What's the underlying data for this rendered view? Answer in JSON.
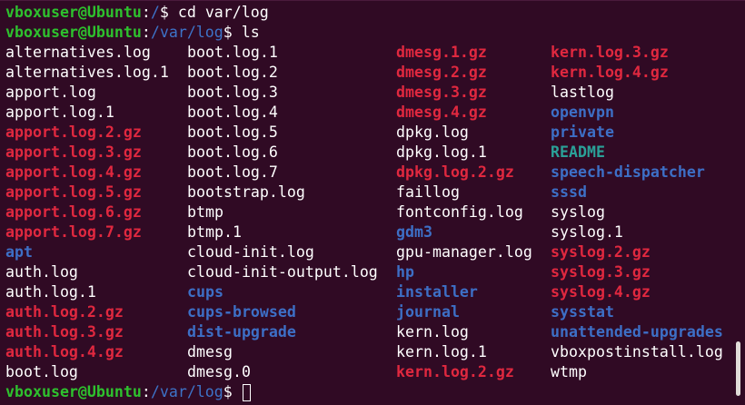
{
  "colors": {
    "background": "#300a24",
    "prompt_user": "#2ec12e",
    "prompt_path": "#3d73c8",
    "text": "#ffffff",
    "archive": "#e0283f",
    "directory": "#3d6fc6",
    "special": "#2aa198"
  },
  "prompts": [
    {
      "user": "vboxuser@Ubuntu",
      "sep": ":",
      "path": "/",
      "dollar": "$ ",
      "command": "cd var/log"
    },
    {
      "user": "vboxuser@Ubuntu",
      "sep": ":",
      "path": "/var/log",
      "dollar": "$ ",
      "command": "ls"
    },
    {
      "user": "vboxuser@Ubuntu",
      "sep": ":",
      "path": "/var/log",
      "dollar": "$ ",
      "command": ""
    }
  ],
  "listing": {
    "col1": [
      {
        "name": "alternatives.log",
        "type": "file"
      },
      {
        "name": "alternatives.log.1",
        "type": "file"
      },
      {
        "name": "apport.log",
        "type": "file"
      },
      {
        "name": "apport.log.1",
        "type": "file"
      },
      {
        "name": "apport.log.2.gz",
        "type": "archive"
      },
      {
        "name": "apport.log.3.gz",
        "type": "archive"
      },
      {
        "name": "apport.log.4.gz",
        "type": "archive"
      },
      {
        "name": "apport.log.5.gz",
        "type": "archive"
      },
      {
        "name": "apport.log.6.gz",
        "type": "archive"
      },
      {
        "name": "apport.log.7.gz",
        "type": "archive"
      },
      {
        "name": "apt",
        "type": "dir"
      },
      {
        "name": "auth.log",
        "type": "file"
      },
      {
        "name": "auth.log.1",
        "type": "file"
      },
      {
        "name": "auth.log.2.gz",
        "type": "archive"
      },
      {
        "name": "auth.log.3.gz",
        "type": "archive"
      },
      {
        "name": "auth.log.4.gz",
        "type": "archive"
      },
      {
        "name": "boot.log",
        "type": "file"
      }
    ],
    "col2": [
      {
        "name": "boot.log.1",
        "type": "file"
      },
      {
        "name": "boot.log.2",
        "type": "file"
      },
      {
        "name": "boot.log.3",
        "type": "file"
      },
      {
        "name": "boot.log.4",
        "type": "file"
      },
      {
        "name": "boot.log.5",
        "type": "file"
      },
      {
        "name": "boot.log.6",
        "type": "file"
      },
      {
        "name": "boot.log.7",
        "type": "file"
      },
      {
        "name": "bootstrap.log",
        "type": "file"
      },
      {
        "name": "btmp",
        "type": "file"
      },
      {
        "name": "btmp.1",
        "type": "file"
      },
      {
        "name": "cloud-init.log",
        "type": "file"
      },
      {
        "name": "cloud-init-output.log",
        "type": "file"
      },
      {
        "name": "cups",
        "type": "dir"
      },
      {
        "name": "cups-browsed",
        "type": "dir"
      },
      {
        "name": "dist-upgrade",
        "type": "dir"
      },
      {
        "name": "dmesg",
        "type": "file"
      },
      {
        "name": "dmesg.0",
        "type": "file"
      }
    ],
    "col3": [
      {
        "name": "dmesg.1.gz",
        "type": "archive"
      },
      {
        "name": "dmesg.2.gz",
        "type": "archive"
      },
      {
        "name": "dmesg.3.gz",
        "type": "archive"
      },
      {
        "name": "dmesg.4.gz",
        "type": "archive"
      },
      {
        "name": "dpkg.log",
        "type": "file"
      },
      {
        "name": "dpkg.log.1",
        "type": "file"
      },
      {
        "name": "dpkg.log.2.gz",
        "type": "archive"
      },
      {
        "name": "faillog",
        "type": "file"
      },
      {
        "name": "fontconfig.log",
        "type": "file"
      },
      {
        "name": "gdm3",
        "type": "dir"
      },
      {
        "name": "gpu-manager.log",
        "type": "file"
      },
      {
        "name": "hp",
        "type": "dir"
      },
      {
        "name": "installer",
        "type": "dir"
      },
      {
        "name": "journal",
        "type": "dir"
      },
      {
        "name": "kern.log",
        "type": "file"
      },
      {
        "name": "kern.log.1",
        "type": "file"
      },
      {
        "name": "kern.log.2.gz",
        "type": "archive"
      }
    ],
    "col4": [
      {
        "name": "kern.log.3.gz",
        "type": "archive"
      },
      {
        "name": "kern.log.4.gz",
        "type": "archive"
      },
      {
        "name": "lastlog",
        "type": "file"
      },
      {
        "name": "openvpn",
        "type": "dir"
      },
      {
        "name": "private",
        "type": "dir"
      },
      {
        "name": "README",
        "type": "special"
      },
      {
        "name": "speech-dispatcher",
        "type": "dir"
      },
      {
        "name": "sssd",
        "type": "dir"
      },
      {
        "name": "syslog",
        "type": "file"
      },
      {
        "name": "syslog.1",
        "type": "file"
      },
      {
        "name": "syslog.2.gz",
        "type": "archive"
      },
      {
        "name": "syslog.3.gz",
        "type": "archive"
      },
      {
        "name": "syslog.4.gz",
        "type": "archive"
      },
      {
        "name": "sysstat",
        "type": "dir"
      },
      {
        "name": "unattended-upgrades",
        "type": "dir"
      },
      {
        "name": "vboxpostinstall.log",
        "type": "file"
      },
      {
        "name": "wtmp",
        "type": "file"
      }
    ]
  }
}
